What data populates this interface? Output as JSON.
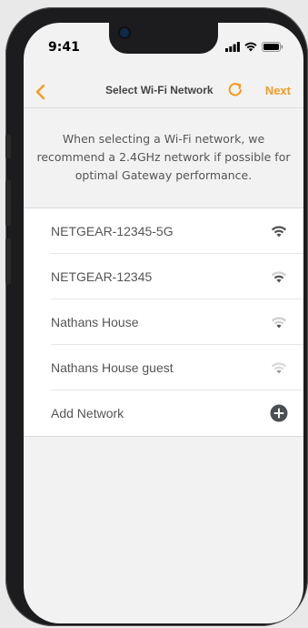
{
  "status": {
    "time": "9:41"
  },
  "nav": {
    "title": "Select Wi-Fi Network",
    "next_label": "Next",
    "accent": "#f59a1e"
  },
  "notice": {
    "lines": [
      "When selecting a Wi-Fi network, we",
      "recommend a 2.4GHz network if possible for",
      "optimal Gateway performance."
    ]
  },
  "networks": [
    {
      "name": "NETGEAR-12345-5G",
      "icon": "wifi-icon",
      "signal": 1.0
    },
    {
      "name": "NETGEAR-12345",
      "icon": "wifi-icon",
      "signal": 0.75
    },
    {
      "name": "Nathans House",
      "icon": "wifi-icon",
      "signal": 0.5
    },
    {
      "name": "Nathans House guest",
      "icon": "wifi-icon",
      "signal": 0.25
    }
  ],
  "add_network": {
    "label": "Add Network",
    "icon": "plus-circle-icon"
  }
}
